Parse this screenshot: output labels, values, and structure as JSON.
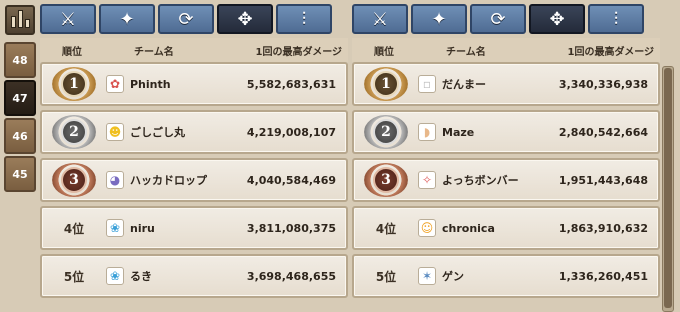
{
  "season_tabs": [
    "48",
    "47",
    "46",
    "45"
  ],
  "active_season_index": 1,
  "weapon_tabs": [
    {
      "icon": "crossed-swords-icon",
      "glyph": "⚔"
    },
    {
      "icon": "magic-staff-icon",
      "glyph": "✦"
    },
    {
      "icon": "bow-icon",
      "glyph": "⟳"
    },
    {
      "icon": "crosshair-icon",
      "glyph": "✥"
    },
    {
      "icon": "claw-weapon-icon",
      "glyph": "⫶"
    }
  ],
  "active_weapon_index": 3,
  "headers": {
    "rank": "順位",
    "team": "チーム名",
    "damage": "1回の最高ダメージ"
  },
  "left_panel": {
    "rows": [
      {
        "rank": "1",
        "rank_label": "",
        "medal": "gold",
        "avatar_glyph": "✿",
        "avatar_color": "#d9534f",
        "team": "Phinth",
        "damage": "5,582,683,631"
      },
      {
        "rank": "2",
        "rank_label": "",
        "medal": "silver",
        "avatar_glyph": "☻",
        "avatar_color": "#f0c020",
        "team": "ごしごし丸",
        "damage": "4,219,008,107"
      },
      {
        "rank": "3",
        "rank_label": "",
        "medal": "bronze",
        "avatar_glyph": "◕",
        "avatar_color": "#7a6cc0",
        "team": "ハッカドロップ",
        "damage": "4,040,584,469"
      },
      {
        "rank": "4",
        "rank_label": "4位",
        "medal": "",
        "avatar_glyph": "❀",
        "avatar_color": "#3aa0d8",
        "team": "niru",
        "damage": "3,811,080,375"
      },
      {
        "rank": "5",
        "rank_label": "5位",
        "medal": "",
        "avatar_glyph": "❀",
        "avatar_color": "#3aa0d8",
        "team": "るき",
        "damage": "3,698,468,655"
      }
    ]
  },
  "right_panel": {
    "rows": [
      {
        "rank": "1",
        "rank_label": "",
        "medal": "gold",
        "avatar_glyph": "▫",
        "avatar_color": "#bfbfbf",
        "team": "だんまー",
        "damage": "3,340,336,938"
      },
      {
        "rank": "2",
        "rank_label": "",
        "medal": "silver",
        "avatar_glyph": "◗",
        "avatar_color": "#e8b88a",
        "team": "Maze",
        "damage": "2,840,542,664"
      },
      {
        "rank": "3",
        "rank_label": "",
        "medal": "bronze",
        "avatar_glyph": "✧",
        "avatar_color": "#e06060",
        "team": "よっちボンバー",
        "damage": "1,951,443,648"
      },
      {
        "rank": "4",
        "rank_label": "4位",
        "medal": "",
        "avatar_glyph": "☺",
        "avatar_color": "#f0a020",
        "team": "chronica",
        "damage": "1,863,910,632"
      },
      {
        "rank": "5",
        "rank_label": "5位",
        "medal": "",
        "avatar_glyph": "✶",
        "avatar_color": "#5a8ac0",
        "team": "ゲン",
        "damage": "1,336,260,451"
      }
    ]
  }
}
